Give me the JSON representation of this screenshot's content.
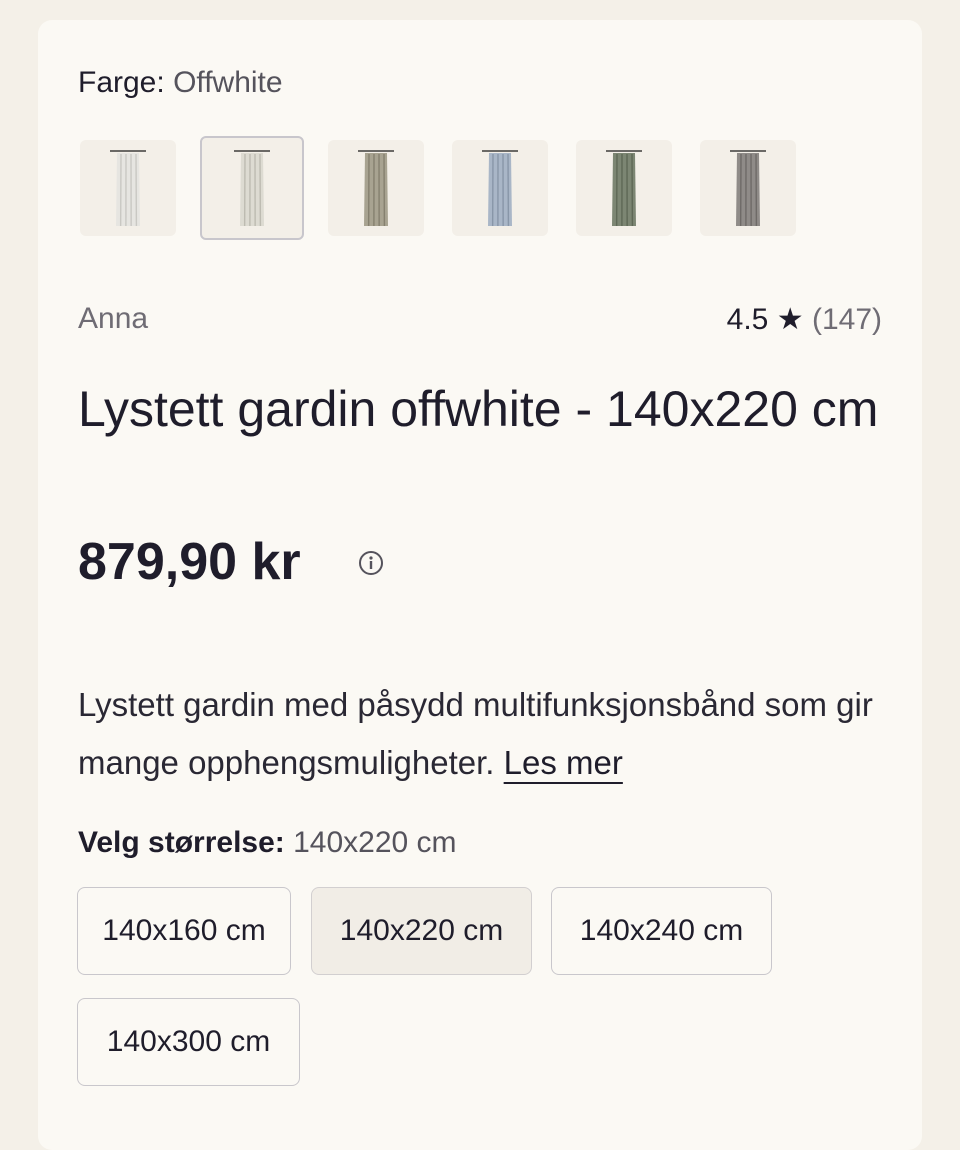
{
  "color": {
    "label": "Farge:",
    "value": "Offwhite"
  },
  "swatches": [
    {
      "name": "offwhite-1",
      "fabric": "#e6e5e1",
      "shadow": "#c9c8c3",
      "selected": false
    },
    {
      "name": "offwhite-2",
      "fabric": "#dddbd2",
      "shadow": "#bdbbb1",
      "selected": true
    },
    {
      "name": "beige",
      "fabric": "#a8a391",
      "shadow": "#85806f",
      "selected": false
    },
    {
      "name": "blue",
      "fabric": "#a9b6c7",
      "shadow": "#8896a8",
      "selected": false
    },
    {
      "name": "green",
      "fabric": "#7c8673",
      "shadow": "#5e6856",
      "selected": false
    },
    {
      "name": "grey",
      "fabric": "#8f8b88",
      "shadow": "#6e6a67",
      "selected": false
    }
  ],
  "product": {
    "brand": "Anna",
    "rating_score": "4.5",
    "rating_star": "★",
    "rating_count": "(147)",
    "title": "Lystett gardin offwhite - 140x220 cm",
    "price": "879,90 kr",
    "description": "Lystett gardin med påsydd multifunksjonsbånd som gir mange opphengsmuligheter.",
    "read_more": "Les mer"
  },
  "size": {
    "label": "Velg størrelse:",
    "value": "140x220 cm",
    "options": [
      "140x160 cm",
      "140x220 cm",
      "140x240 cm",
      "140x300 cm"
    ],
    "selected_index": 1
  },
  "colors": {
    "text": "#1f1d2b",
    "muted": "#6f6c74",
    "background": "#f4f0e8",
    "card": "#fbf9f4"
  }
}
